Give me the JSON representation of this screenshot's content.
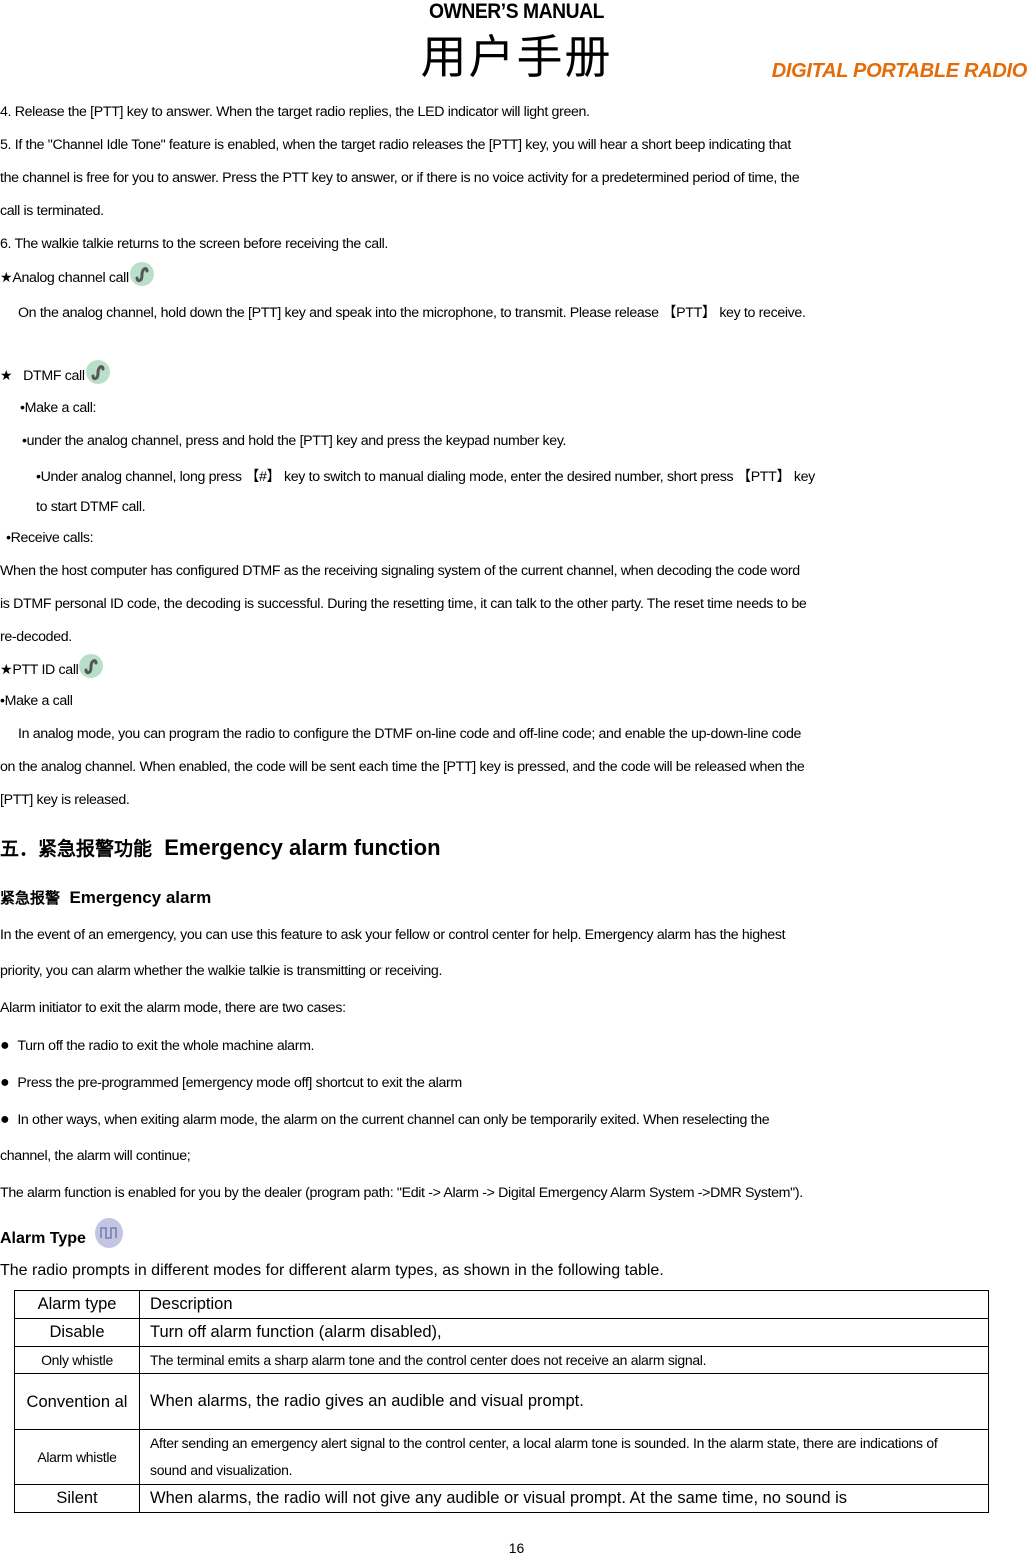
{
  "header": {
    "title_en": "OWNER’S MANUAL",
    "title_cn": "用户手册",
    "subtitle": "DIGITAL PORTABLE RADIO",
    "subtitle_color": "#e36c09"
  },
  "steps": [
    "4. Release the [PTT] key to answer. When the target radio replies, the LED indicator will light green.",
    "5. If the \"Channel Idle Tone\" feature is enabled, when the target radio releases the [PTT] key, you will hear a short beep indicating that",
    "the channel is free for you to answer. Press the PTT key to answer, or if there is no voice activity for a predetermined period of time, the",
    "call is terminated.",
    "6. The walkie talkie returns to the screen before receiving the call."
  ],
  "analog_call": {
    "star": "★",
    "title": "Analog channel call",
    "icon": "analog-mode-icon",
    "text": "On the analog channel, hold down the [PTT] key and speak into the microphone, to transmit. Please release 【PTT】 key to receive."
  },
  "dtmf_call": {
    "star": "★",
    "title": "DTMF call",
    "icon": "analog-mode-icon",
    "make_call": "•Make a call:",
    "line1": "•under the analog channel, press and hold the [PTT] key and press the keypad number key.",
    "line2": "•Under analog channel, long press 【#】 key to switch to manual dialing mode, enter the desired number, short press 【PTT】 key",
    "line2b": "to start DTMF call.",
    "receive": "•Receive calls:",
    "receive_lines": [
      "When the host computer has configured DTMF as the receiving signaling system of the current channel, when decoding the code word",
      "is DTMF personal ID code, the decoding is successful. During the resetting time, it can talk to the other party. The reset time needs to be",
      "re-decoded."
    ]
  },
  "ptt_id_call": {
    "star": "★",
    "title": "PTT ID call",
    "icon": "analog-mode-icon",
    "make_call": "•Make a call",
    "lines": [
      "In analog mode, you can program the radio to configure the DTMF on-line code and off-line code; and enable the up-down-line code",
      "on the analog channel. When enabled, the code will be sent each time the [PTT] key is pressed, and the code will be released when the",
      "[PTT] key is released."
    ]
  },
  "section5": {
    "title_cn": "五．紧急报警功能",
    "title_en": "Emergency alarm function",
    "sub_cn": "紧急报警",
    "sub_en": "Emergency alarm",
    "intro": [
      "In the event of an emergency, you can use this feature to ask your fellow or control center for help. Emergency alarm has the highest",
      "priority, you can alarm whether the walkie talkie is transmitting or receiving."
    ],
    "exit_intro": "Alarm initiator to exit the alarm mode, there are two cases:",
    "bullets": [
      "Turn off the radio to exit the whole machine alarm.",
      "Press the pre-programmed [emergency mode off] shortcut to exit the alarm",
      "In other ways, when exiting alarm mode, the alarm on the current channel can only be temporarily exited. When reselecting the"
    ],
    "bullet_cont": "channel, the alarm will continue;",
    "program_path": "The alarm function is enabled for you by the dealer (program path: \"Edit -> Alarm -> Digital Emergency Alarm System ->DMR System\").",
    "alarm_type_title": "Alarm Type",
    "alarm_type_icon": "digital-mode-icon",
    "alarm_type_intro": "The radio prompts in different modes for different alarm types, as shown in the following table."
  },
  "alarm_table": {
    "headers": [
      "Alarm type",
      "Description"
    ],
    "rows": [
      {
        "type": "Disable",
        "desc": "Turn off alarm function (alarm disabled),"
      },
      {
        "type": "Only whistle",
        "desc": "The terminal emits a sharp alarm tone and the control center does not receive an alarm signal."
      },
      {
        "type": "Convention al",
        "desc": "When alarms, the radio gives an audible and visual prompt."
      },
      {
        "type": "Alarm whistle",
        "desc": "After sending an emergency alert signal to the control center, a local alarm tone is sounded. In the alarm state, there are indications of sound and visualization."
      },
      {
        "type": "Silent",
        "desc": "When alarms, the radio will not give any audible or visual prompt. At the same time, no sound is"
      }
    ]
  },
  "footer": {
    "page_number": "16"
  }
}
